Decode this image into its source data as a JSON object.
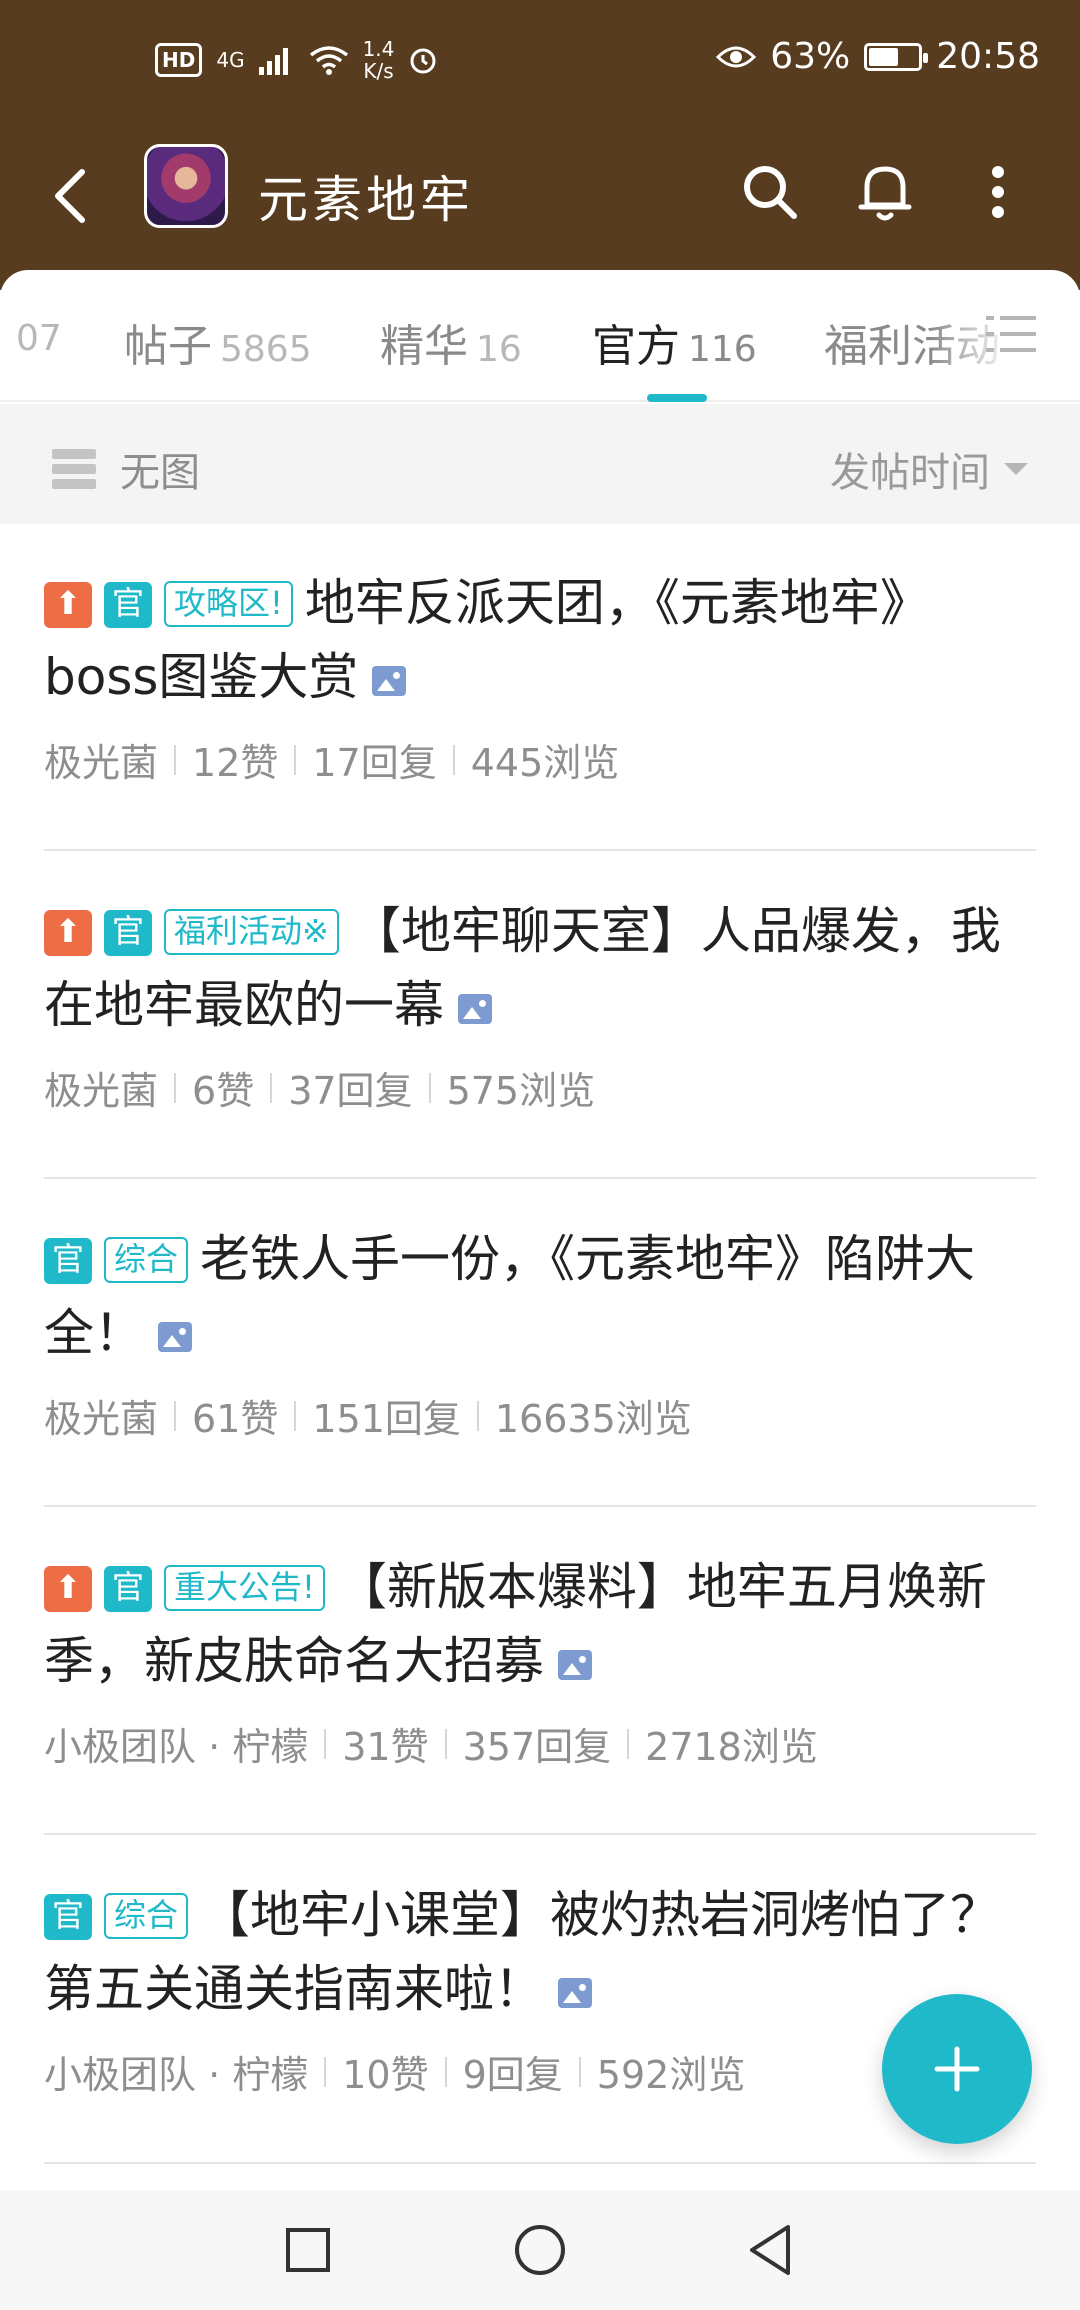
{
  "status_bar": {
    "hd": "HD",
    "network": "4G",
    "speed_top": "1.4",
    "speed_bottom": "K/s",
    "battery_percent": "63%",
    "battery_level": 0.63,
    "time": "20:58"
  },
  "app_bar": {
    "title": "元素地牢",
    "icons": [
      "back-arrow-icon",
      "game-icon",
      "search-icon",
      "bell-icon",
      "more-vertical-icon"
    ]
  },
  "tabs": [
    {
      "label": "",
      "count": "07"
    },
    {
      "label": "帖子",
      "count": "5865"
    },
    {
      "label": "精华",
      "count": "16"
    },
    {
      "label": "官方",
      "count": "116",
      "active": true
    },
    {
      "label": "福利活动",
      "count": ""
    }
  ],
  "filter": {
    "left_label": "无图",
    "right_label": "发帖时间"
  },
  "posts": [
    {
      "pinned": true,
      "official_tag": "官",
      "category": "攻略区!",
      "title": "地牢反派天团，《元素地牢》boss图鉴大赏",
      "author": "极光菌",
      "likes": "12赞",
      "replies": "17回复",
      "views": "445浏览"
    },
    {
      "pinned": true,
      "official_tag": "官",
      "category": "福利活动※",
      "title": "【地牢聊天室】人品爆发，我在地牢最欧的一幕",
      "author": "极光菌",
      "likes": "6赞",
      "replies": "37回复",
      "views": "575浏览"
    },
    {
      "pinned": false,
      "official_tag": "官",
      "category": "综合",
      "title": "老铁人手一份，《元素地牢》陷阱大全！",
      "author": "极光菌",
      "likes": "61赞",
      "replies": "151回复",
      "views": "16635浏览"
    },
    {
      "pinned": true,
      "official_tag": "官",
      "category": "重大公告!",
      "title": "【新版本爆料】地牢五月焕新季，新皮肤命名大招募",
      "author": "小极团队 · 柠檬",
      "likes": "31赞",
      "replies": "357回复",
      "views": "2718浏览"
    },
    {
      "pinned": false,
      "official_tag": "官",
      "category": "综合",
      "title": "【地牢小课堂】被灼热岩洞烤怕了？第五关通关指南来啦！",
      "author": "小极团队 · 柠檬",
      "likes": "10赞",
      "replies": "9回复",
      "views": "592浏览"
    }
  ],
  "colors": {
    "header": "#573c1f",
    "accent": "#1fb9c9",
    "pin": "#ee6d45"
  }
}
